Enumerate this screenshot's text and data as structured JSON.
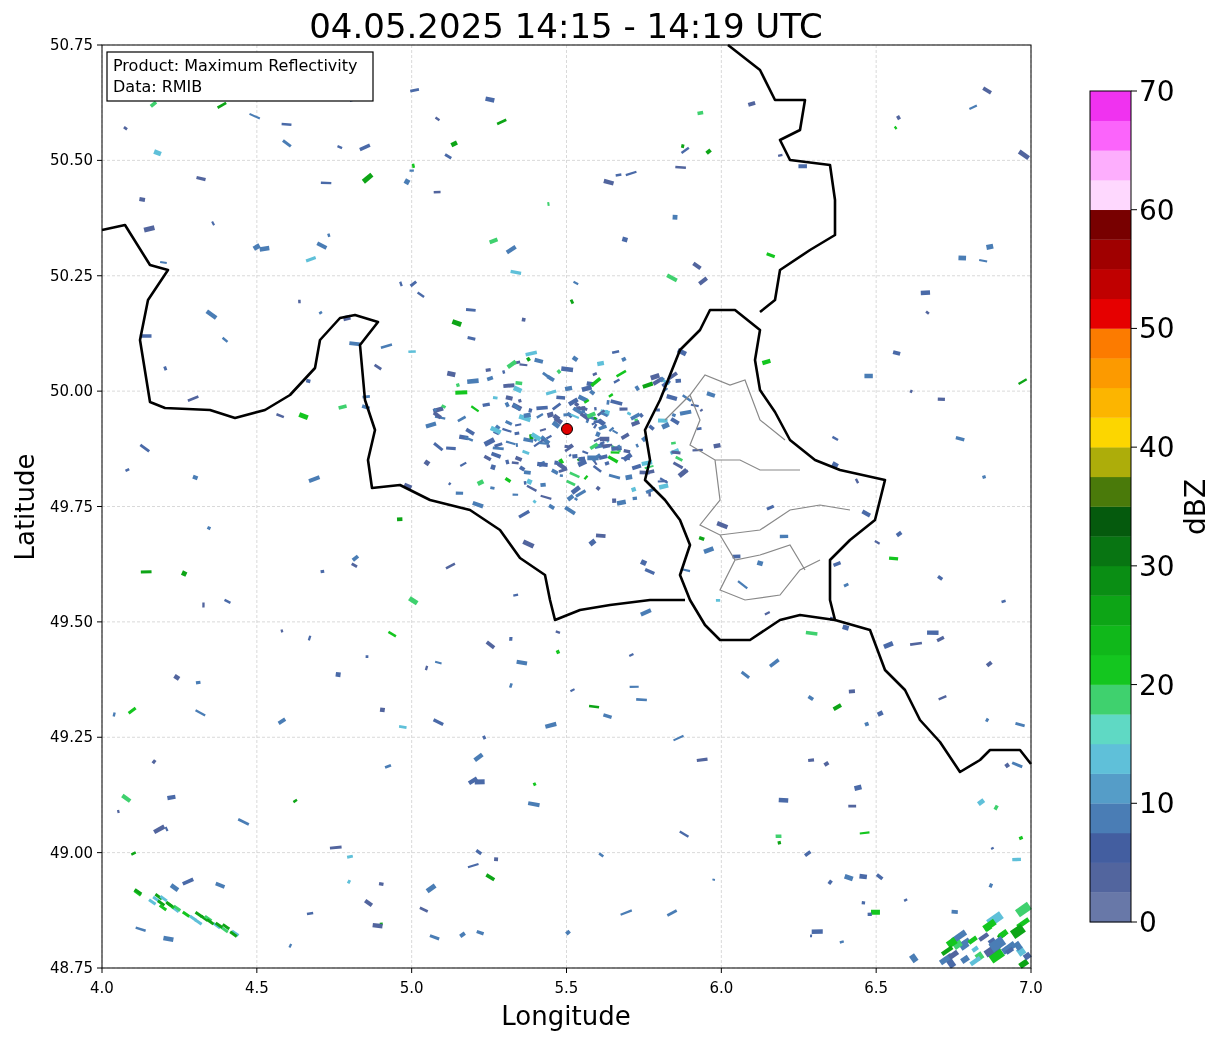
{
  "title": "04.05.2025 14:15 - 14:19 UTC",
  "legend": [
    "Product: Maximum Reflectivity",
    "Data: RMIB"
  ],
  "x_axis": {
    "label": "Longitude",
    "ticks": [
      "4.0",
      "4.5",
      "5.0",
      "5.5",
      "6.0",
      "6.5",
      "7.0"
    ]
  },
  "y_axis": {
    "label": "Latitude",
    "ticks": [
      "50.75",
      "50.50",
      "50.25",
      "50.00",
      "49.75",
      "49.50",
      "49.25",
      "49.00",
      "48.75"
    ]
  },
  "colorbar": {
    "label": "dBZ",
    "ticks": [
      "70",
      "60",
      "50",
      "40",
      "30",
      "20",
      "10",
      "0"
    ],
    "segments": [
      {
        "color": "#6878a8"
      },
      {
        "color": "#52659e"
      },
      {
        "color": "#435ea0"
      },
      {
        "color": "#4a7db5"
      },
      {
        "color": "#559dc8"
      },
      {
        "color": "#5fc0d9"
      },
      {
        "color": "#5fd9c4"
      },
      {
        "color": "#3fd16e"
      },
      {
        "color": "#14c61f"
      },
      {
        "color": "#10b81a"
      },
      {
        "color": "#0da516"
      },
      {
        "color": "#0a8e14"
      },
      {
        "color": "#087512"
      },
      {
        "color": "#055a0d"
      },
      {
        "color": "#4a7a0a"
      },
      {
        "color": "#adad0a"
      },
      {
        "color": "#fcd600"
      },
      {
        "color": "#fcb500"
      },
      {
        "color": "#fc9a00"
      },
      {
        "color": "#fc7b00"
      },
      {
        "color": "#e60000"
      },
      {
        "color": "#c00000"
      },
      {
        "color": "#a00000"
      },
      {
        "color": "#780000"
      },
      {
        "color": "#fed8fe"
      },
      {
        "color": "#fdaefd"
      },
      {
        "color": "#fb64fb"
      },
      {
        "color": "#f032f0"
      }
    ]
  }
}
